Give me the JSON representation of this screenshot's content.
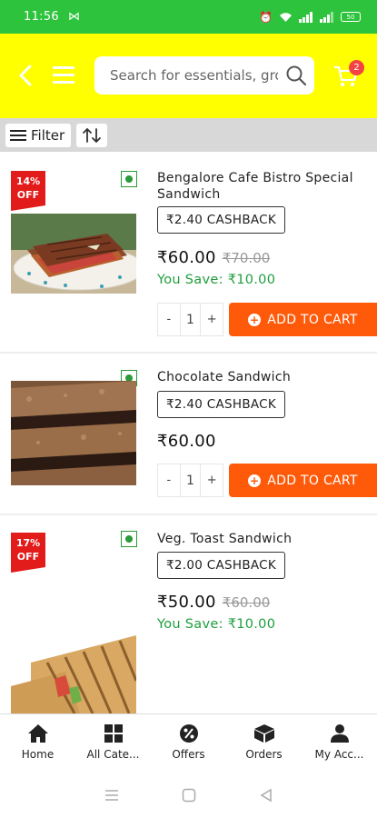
{
  "status_bar": {
    "time": "11:56",
    "battery": "50"
  },
  "header": {
    "search_placeholder": "Search for essentials, groceries",
    "cart_count": "2"
  },
  "filter_bar": {
    "filter_label": "Filter"
  },
  "products": [
    {
      "discount": [
        "14%",
        "OFF"
      ],
      "name": "Bengalore Cafe Bistro Special Sandwich",
      "cashback": "₹2.40 CASHBACK",
      "price": "₹60.00",
      "mrp": "₹70.00",
      "you_save": "You Save: ₹10.00",
      "qty": "1",
      "add_label": "ADD TO CART"
    },
    {
      "name": "Chocolate Sandwich",
      "cashback": "₹2.40 CASHBACK",
      "price": "₹60.00",
      "qty": "1",
      "add_label": "ADD TO CART"
    },
    {
      "discount": [
        "17%",
        "OFF"
      ],
      "name": "Veg. Toast Sandwich",
      "cashback": "₹2.00 CASHBACK",
      "price": "₹50.00",
      "mrp": "₹60.00",
      "you_save": "You Save: ₹10.00"
    }
  ],
  "stepper": {
    "minus": "-",
    "plus": "+"
  },
  "bottom_nav": [
    {
      "label": "Home",
      "icon": "home-icon"
    },
    {
      "label": "All Cate...",
      "icon": "grid-icon"
    },
    {
      "label": "Offers",
      "icon": "offers-icon"
    },
    {
      "label": "Orders",
      "icon": "box-icon"
    },
    {
      "label": "My Acc...",
      "icon": "user-icon"
    }
  ],
  "colors": {
    "status_bar": "#2ec33d",
    "header": "#ffff00",
    "accent": "#ff5a0a",
    "discount": "#e21b1b",
    "save": "#1e9e3c"
  }
}
